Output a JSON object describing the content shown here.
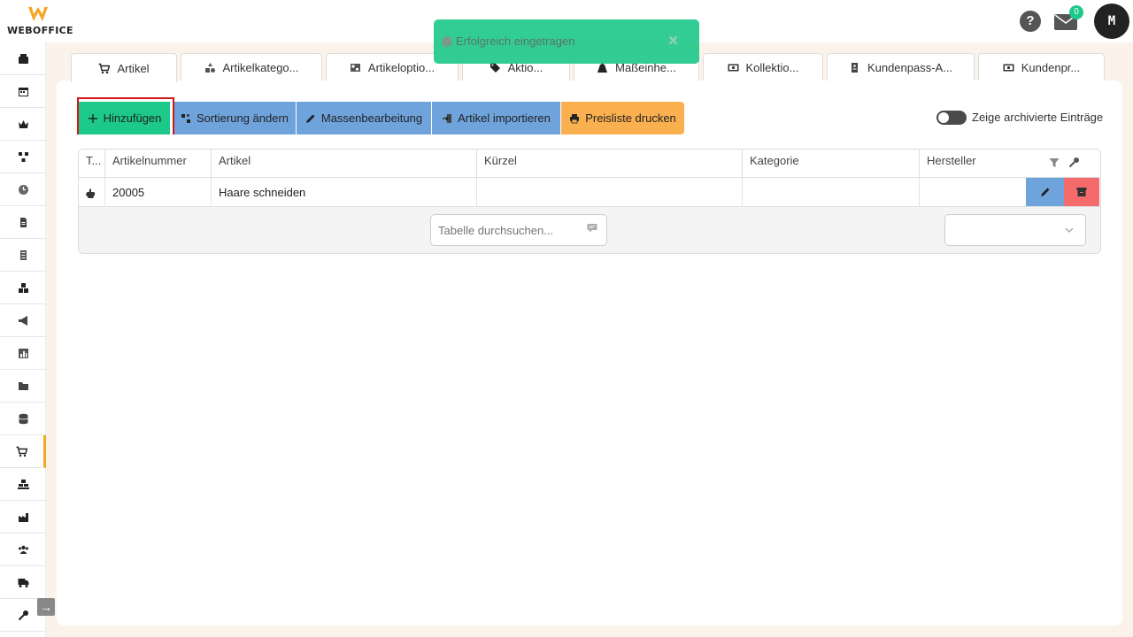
{
  "brand": {
    "name": "WEBOFFICE",
    "colors": {
      "accent": "#f5a623",
      "green": "#1cc88a",
      "blue": "#6fa3dc",
      "orange": "#fbb04f",
      "red": "#f56a6a"
    }
  },
  "header": {
    "help_label": "?",
    "mail_count": "0",
    "avatar_initial": "M"
  },
  "toast": {
    "message": "Erfolgreich eingetragen",
    "close": "×"
  },
  "sidebar": {
    "items": [
      "cash-register-icon",
      "calendar-icon",
      "crown-icon",
      "network-icon",
      "clock-icon",
      "document-icon",
      "list-icon",
      "boxes-icon",
      "megaphone-icon",
      "chart-icon",
      "folder-icon",
      "database-icon",
      "cart-icon",
      "warehouse-icon",
      "industry-icon",
      "users-icon",
      "truck-icon",
      "key-icon"
    ],
    "active": "cart-icon"
  },
  "tabs": [
    {
      "label": "Artikel",
      "icon": "cart-icon"
    },
    {
      "label": "Artikelkatego...",
      "icon": "shapes-icon"
    },
    {
      "label": "Artikeloptio...",
      "icon": "options-icon"
    },
    {
      "label": "Aktio...",
      "icon": "tag-icon"
    },
    {
      "label": "Maßeinhe...",
      "icon": "weight-icon"
    },
    {
      "label": "Kollektio...",
      "icon": "collection-icon"
    },
    {
      "label": "Kundenpass-A...",
      "icon": "id-card-icon"
    },
    {
      "label": "Kundenpr...",
      "icon": "money-icon"
    }
  ],
  "toolbar": {
    "add": "Hinzufügen",
    "sort": "Sortierung ändern",
    "bulk_edit": "Massenbearbeitung",
    "import": "Artikel importieren",
    "print": "Preisliste drucken",
    "archived_toggle_label": "Zeige archivierte Einträge"
  },
  "table": {
    "columns": [
      "T...",
      "Artikelnummer",
      "Artikel",
      "Kürzel",
      "Kategorie",
      "Hersteller"
    ],
    "rows": [
      {
        "type_icon": "hand-icon",
        "number": "20005",
        "article": "Haare schneiden",
        "short": "",
        "category": "",
        "manufacturer": ""
      }
    ],
    "search_placeholder": "Tabelle durchsuchen...",
    "page_select": ""
  }
}
